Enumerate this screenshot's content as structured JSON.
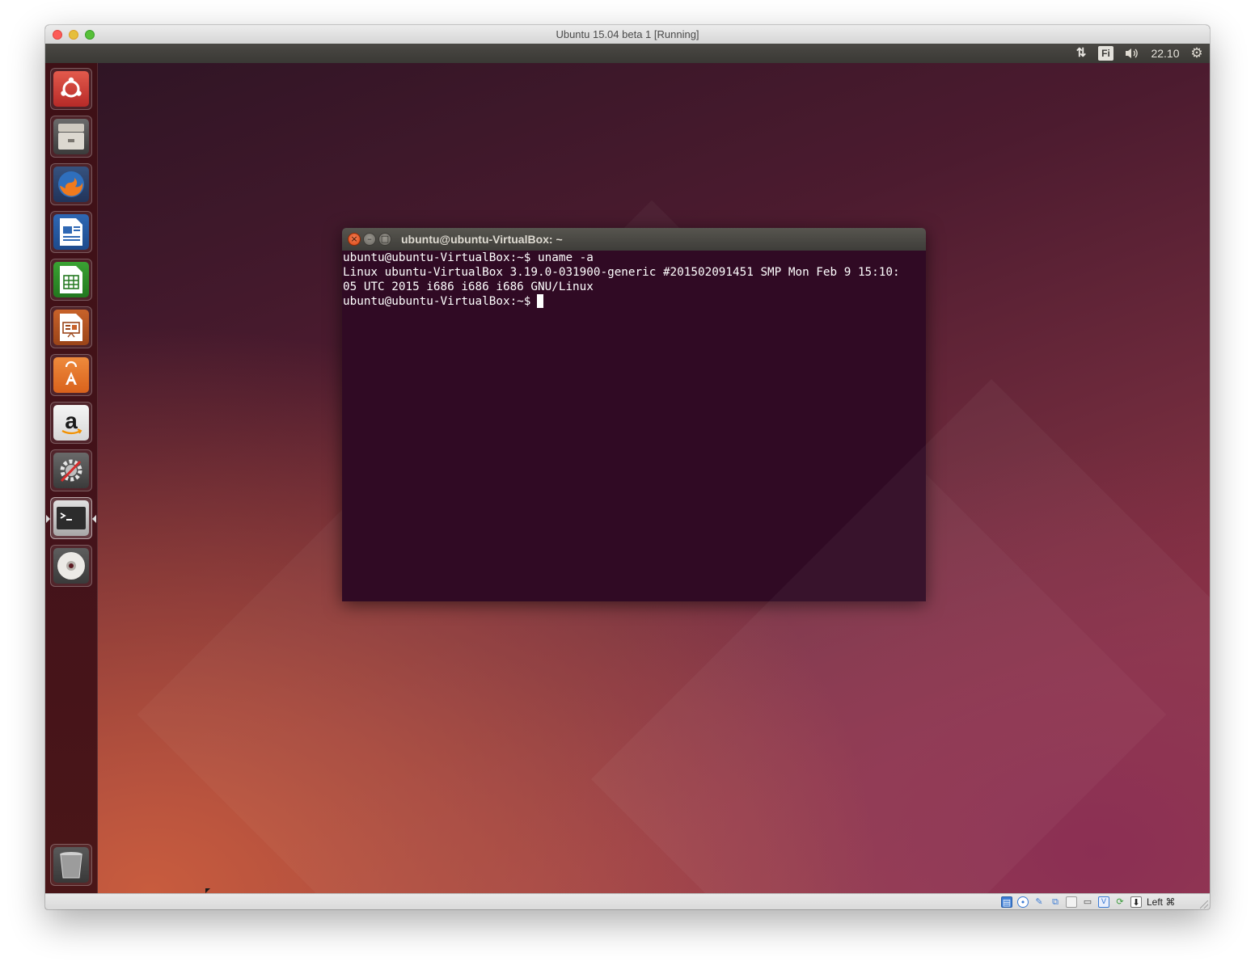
{
  "host_window": {
    "title": "Ubuntu 15.04 beta 1 [Running]"
  },
  "top_panel": {
    "network_icon": "network-arrows-icon",
    "keyboard_layout": "Fi",
    "volume_icon": "speaker-icon",
    "clock": "22.10",
    "settings_icon": "gear-icon"
  },
  "launcher": {
    "items": [
      {
        "name": "dash-home",
        "icon": "ubuntu-logo-icon"
      },
      {
        "name": "files",
        "icon": "file-cabinet-icon"
      },
      {
        "name": "firefox",
        "icon": "firefox-icon"
      },
      {
        "name": "libreoffice-writer",
        "icon": "writer-document-icon"
      },
      {
        "name": "libreoffice-calc",
        "icon": "calc-spreadsheet-icon"
      },
      {
        "name": "libreoffice-impress",
        "icon": "impress-presentation-icon"
      },
      {
        "name": "software-center",
        "icon": "shopping-bag-icon"
      },
      {
        "name": "amazon",
        "icon": "amazon-icon"
      },
      {
        "name": "system-settings",
        "icon": "settings-wrench-gear-icon"
      },
      {
        "name": "terminal",
        "icon": "terminal-icon",
        "active": true
      },
      {
        "name": "disc",
        "icon": "optical-disc-icon"
      },
      {
        "name": "trash",
        "icon": "trash-icon"
      }
    ]
  },
  "terminal": {
    "title": "ubuntu@ubuntu-VirtualBox: ~",
    "lines": [
      "ubuntu@ubuntu-VirtualBox:~$ uname -a",
      "Linux ubuntu-VirtualBox 3.19.0-031900-generic #201502091451 SMP Mon Feb 9 15:10:",
      "05 UTC 2015 i686 i686 i686 GNU/Linux",
      "ubuntu@ubuntu-VirtualBox:~$ "
    ],
    "background": "#300a24"
  },
  "status_bar": {
    "icons": [
      "hard-disk-icon",
      "optical-drive-icon",
      "usb-icon",
      "shared-folders-icon",
      "display-icon",
      "network-adapter-icon",
      "video-capture-icon",
      "guest-additions-icon",
      "mouse-integration-icon"
    ],
    "host_key": "Left ⌘"
  }
}
